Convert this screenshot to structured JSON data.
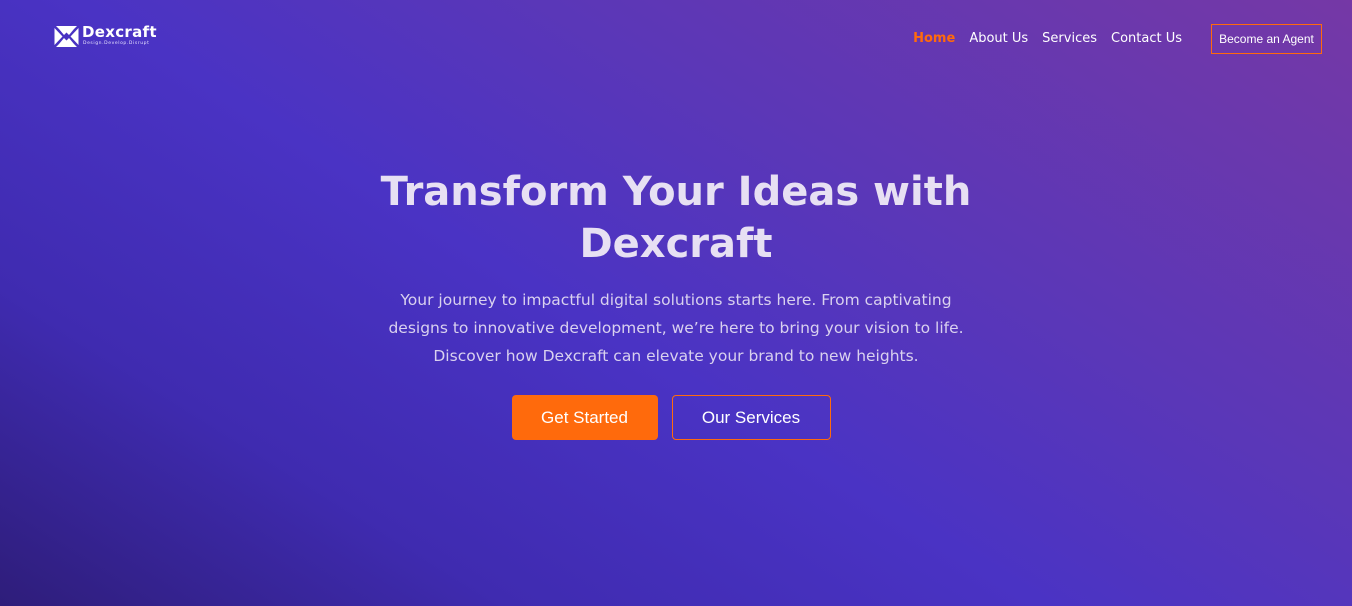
{
  "brand": {
    "name": "Dexcraft",
    "tagline": "Design.Develop.Disrupt",
    "logo_icon": "dexcraft-logo-icon",
    "accent_color": "#ff6a0c"
  },
  "nav": {
    "items": [
      {
        "label": "Home",
        "active": true
      },
      {
        "label": "About Us",
        "active": false
      },
      {
        "label": "Services",
        "active": false
      },
      {
        "label": "Contact Us",
        "active": false
      }
    ],
    "cta_label": "Become an Agent"
  },
  "hero": {
    "title": "Transform Your Ideas with Dexcraft",
    "description": "Your journey to impactful digital solutions starts here. From captivating designs to innovative development, we’re here to bring your vision to life. Discover how Dexcraft can elevate your brand to new heights.",
    "primary_button": "Get Started",
    "secondary_button": "Our Services"
  }
}
